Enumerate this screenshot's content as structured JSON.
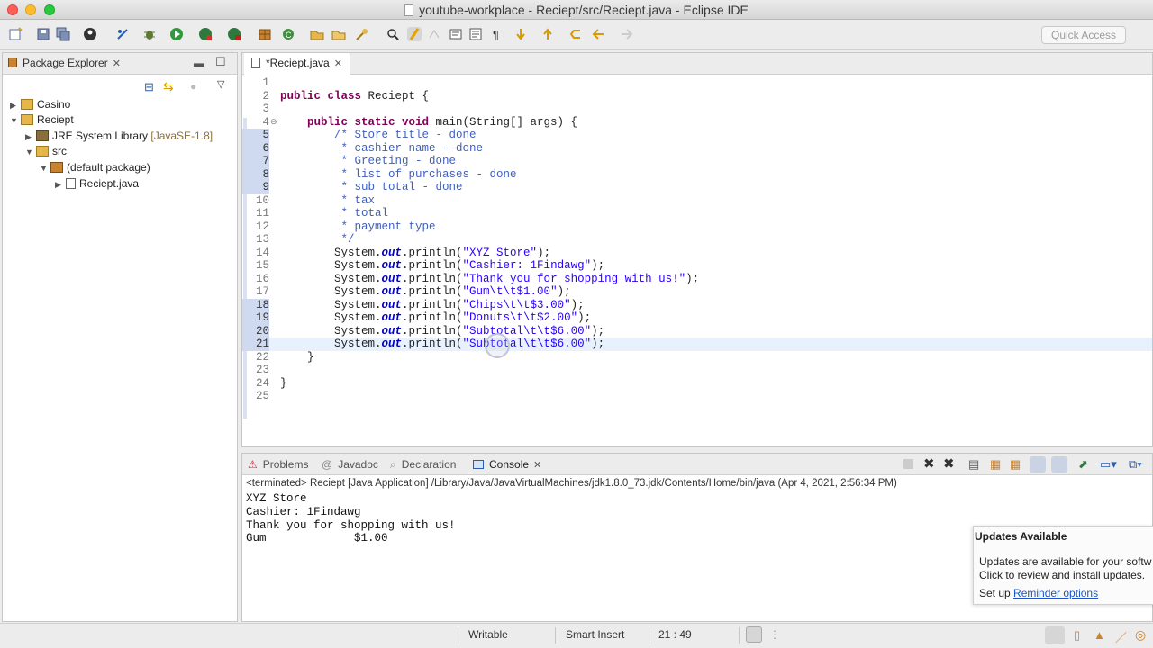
{
  "window": {
    "title": "youtube-workplace - Reciept/src/Reciept.java - Eclipse IDE"
  },
  "toolbar": {
    "quick_access_placeholder": "Quick Access",
    "icons": [
      "new-wizard-icon",
      "save-icon",
      "save-all-icon",
      "profile-icon",
      "skip-breakpoints-icon",
      "debug-icon",
      "run-icon",
      "coverage-icon",
      "external-tools-icon",
      "new-package-icon",
      "new-class-icon",
      "open-type-icon",
      "open-task-icon",
      "search-icon",
      "toggle-mark-occurrences-icon",
      "highlight-icon",
      "block-selection-icon",
      "open-console-icon",
      "toggle-word-wrap-icon",
      "show-whitespace-icon",
      "next-annotation-icon",
      "prev-annotation-icon",
      "last-edit-icon",
      "back-icon",
      "forward-icon"
    ]
  },
  "package_explorer": {
    "title": "Package Explorer",
    "tree": [
      {
        "label": "Casino",
        "twisty": "▶",
        "icon": "project-icon"
      },
      {
        "label": "Reciept",
        "twisty": "▼",
        "icon": "project-icon"
      },
      {
        "label": "JRE System Library",
        "suffix": "[JavaSE-1.8]",
        "twisty": "▶",
        "icon": "library-icon"
      },
      {
        "label": "src",
        "twisty": "▼",
        "icon": "source-folder-icon"
      },
      {
        "label": "(default package)",
        "twisty": "▼",
        "icon": "package-icon"
      },
      {
        "label": "Reciept.java",
        "twisty": "▶",
        "icon": "java-file-icon"
      }
    ]
  },
  "editor": {
    "tab_label": "*Reciept.java",
    "cursor_position": "21 : 49",
    "line_numbers": [
      "1",
      "2",
      "3",
      "4",
      "5",
      "6",
      "7",
      "8",
      "9",
      "10",
      "11",
      "12",
      "13",
      "14",
      "15",
      "16",
      "17",
      "18",
      "19",
      "20",
      "21",
      "22",
      "23",
      "24",
      "25"
    ],
    "code": {
      "l2_kw": "public class",
      "l2_rest": " Reciept {",
      "l4_kw": "public static void",
      "l4_rest": " main(String[] args) {",
      "l5": "/* Store title - done",
      "l6": " * cashier name - done",
      "l7": " * Greeting - done",
      "l8": " * list of purchases - done",
      "l9": " * sub total - done",
      "l10": " * tax",
      "l11": " * total",
      "l12": " * payment type",
      "l13": " */",
      "sys": "System.",
      "out": "out",
      "println": ".println(",
      "end": ");",
      "s14": "\"XYZ Store\"",
      "s15": "\"Cashier: 1Findawg\"",
      "s16": "\"Thank you for shopping with us!\"",
      "s17": "\"Gum\\t\\t$1.00\"",
      "s18": "\"Chips\\t\\t$3.00\"",
      "s19": "\"Donuts\\t\\t$2.00\"",
      "s20": "\"Subtotal\\t\\t$6.00\"",
      "s21": "\"Subtotal\\t\\t$6.00\"",
      "l22": "}",
      "l24": "}"
    }
  },
  "console": {
    "tabs": [
      "Problems",
      "Javadoc",
      "Declaration",
      "Console"
    ],
    "active_tab": "Console",
    "status": "<terminated> Reciept [Java Application] /Library/Java/JavaVirtualMachines/jdk1.8.0_73.jdk/Contents/Home/bin/java (Apr 4, 2021, 2:56:34 PM)",
    "output": [
      "XYZ Store",
      "Cashier: 1Findawg",
      "Thank you for shopping with us!",
      "Gum\t\t$1.00"
    ]
  },
  "updates_popup": {
    "title": "Updates Available",
    "body_line1": "Updates are available for your softw",
    "body_line2": "Click to review and install updates.",
    "setup_prefix": "Set up ",
    "setup_link": "Reminder options"
  },
  "statusbar": {
    "mode": "Writable",
    "insert_mode": "Smart Insert",
    "position": "21 : 49"
  },
  "colors": {
    "keyword": "#7f0055",
    "comment": "#3f5fbf",
    "string": "#2a00ff",
    "field": "#0000c0",
    "current_line": "#e8f2fe"
  }
}
